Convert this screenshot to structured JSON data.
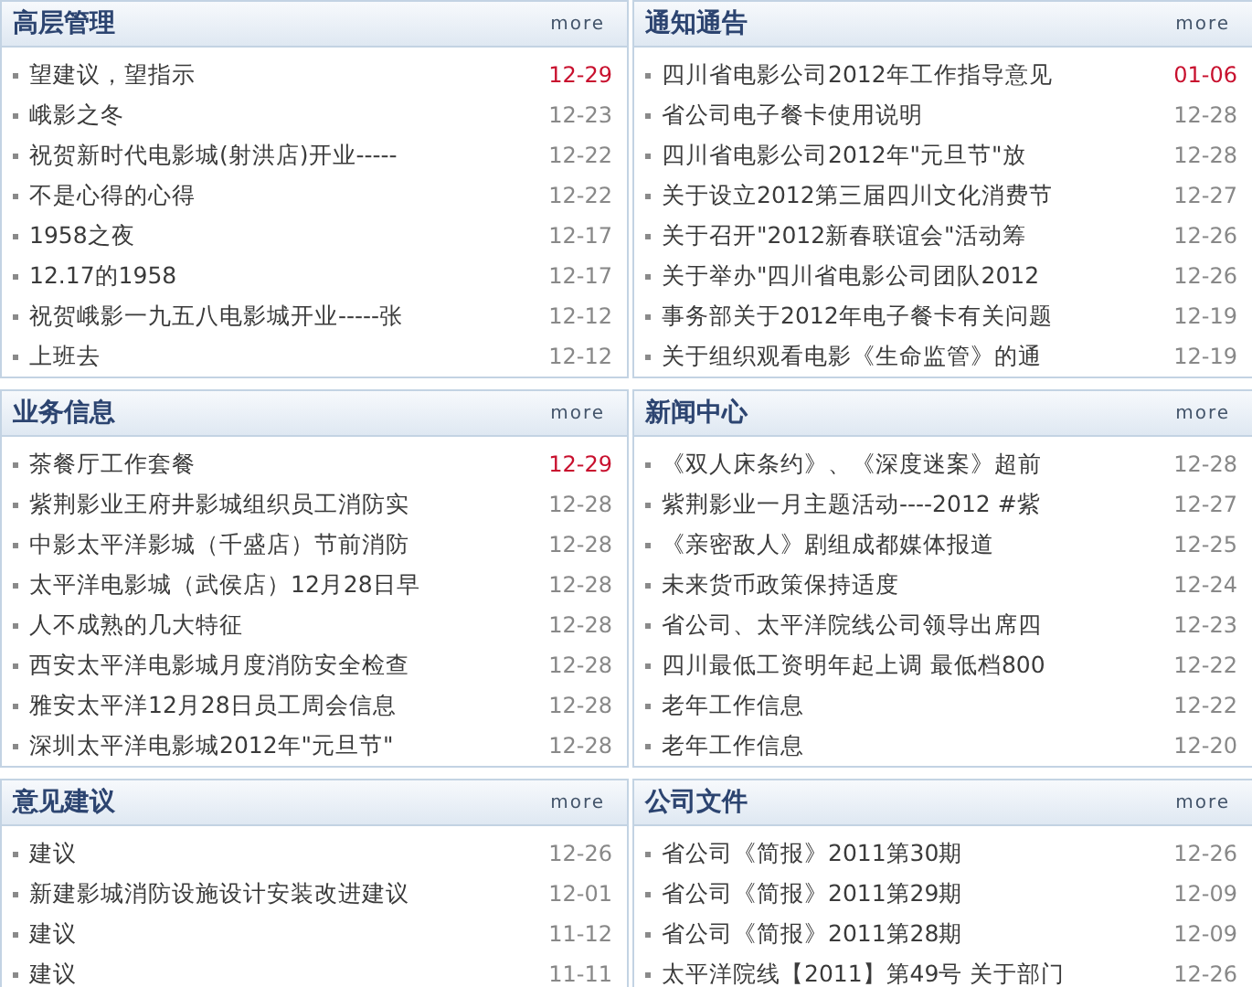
{
  "panels": [
    {
      "title": "高层管理",
      "more": "more",
      "items": [
        {
          "title": "望建议，望指示",
          "date": "12-29",
          "new": true
        },
        {
          "title": "峨影之冬",
          "date": "12-23",
          "new": false
        },
        {
          "title": "祝贺新时代电影城(射洪店)开业-----",
          "date": "12-22",
          "new": false
        },
        {
          "title": "不是心得的心得",
          "date": "12-22",
          "new": false
        },
        {
          "title": "1958之夜",
          "date": "12-17",
          "new": false
        },
        {
          "title": "12.17的1958",
          "date": "12-17",
          "new": false
        },
        {
          "title": "祝贺峨影一九五八电影城开业-----张",
          "date": "12-12",
          "new": false
        },
        {
          "title": "上班去",
          "date": "12-12",
          "new": false
        }
      ]
    },
    {
      "title": "通知通告",
      "more": "more",
      "items": [
        {
          "title": "四川省电影公司2012年工作指导意见",
          "date": "01-06",
          "new": true
        },
        {
          "title": "省公司电子餐卡使用说明",
          "date": "12-28",
          "new": false
        },
        {
          "title": "四川省电影公司2012年\"元旦节\"放",
          "date": "12-28",
          "new": false
        },
        {
          "title": "关于设立2012第三届四川文化消费节",
          "date": "12-27",
          "new": false
        },
        {
          "title": "关于召开\"2012新春联谊会\"活动筹",
          "date": "12-26",
          "new": false
        },
        {
          "title": "关于举办\"四川省电影公司团队2012",
          "date": "12-26",
          "new": false
        },
        {
          "title": "事务部关于2012年电子餐卡有关问题",
          "date": "12-19",
          "new": false
        },
        {
          "title": "关于组织观看电影《生命监管》的通",
          "date": "12-19",
          "new": false
        }
      ]
    },
    {
      "title": "业务信息",
      "more": "more",
      "items": [
        {
          "title": "茶餐厅工作套餐",
          "date": "12-29",
          "new": true
        },
        {
          "title": "紫荆影业王府井影城组织员工消防实",
          "date": "12-28",
          "new": false
        },
        {
          "title": "中影太平洋影城（千盛店）节前消防",
          "date": "12-28",
          "new": false
        },
        {
          "title": "太平洋电影城（武侯店）12月28日早",
          "date": "12-28",
          "new": false
        },
        {
          "title": "人不成熟的几大特征",
          "date": "12-28",
          "new": false
        },
        {
          "title": "西安太平洋电影城月度消防安全检查",
          "date": "12-28",
          "new": false
        },
        {
          "title": "雅安太平洋12月28日员工周会信息",
          "date": "12-28",
          "new": false
        },
        {
          "title": "深圳太平洋电影城2012年\"元旦节\"",
          "date": "12-28",
          "new": false
        }
      ]
    },
    {
      "title": "新闻中心",
      "more": "more",
      "items": [
        {
          "title": "《双人床条约》、《深度迷案》超前",
          "date": "12-28",
          "new": false
        },
        {
          "title": "紫荆影业一月主题活动----2012 #紫",
          "date": "12-27",
          "new": false
        },
        {
          "title": "《亲密敌人》剧组成都媒体报道",
          "date": "12-25",
          "new": false
        },
        {
          "title": "未来货币政策保持适度",
          "date": "12-24",
          "new": false
        },
        {
          "title": "省公司、太平洋院线公司领导出席四",
          "date": "12-23",
          "new": false
        },
        {
          "title": "四川最低工资明年起上调 最低档800",
          "date": "12-22",
          "new": false
        },
        {
          "title": "老年工作信息",
          "date": "12-22",
          "new": false
        },
        {
          "title": "老年工作信息",
          "date": "12-20",
          "new": false
        }
      ]
    },
    {
      "title": "意见建议",
      "more": "more",
      "items": [
        {
          "title": "建议",
          "date": "12-26",
          "new": false
        },
        {
          "title": "新建影城消防设施设计安装改进建议",
          "date": "12-01",
          "new": false
        },
        {
          "title": "建议",
          "date": "11-12",
          "new": false
        },
        {
          "title": "建议",
          "date": "11-11",
          "new": false
        }
      ]
    },
    {
      "title": "公司文件",
      "more": "more",
      "items": [
        {
          "title": "省公司《简报》2011第30期",
          "date": "12-26",
          "new": false
        },
        {
          "title": "省公司《简报》2011第29期",
          "date": "12-09",
          "new": false
        },
        {
          "title": "省公司《简报》2011第28期",
          "date": "12-09",
          "new": false
        },
        {
          "title": "太平洋院线【2011】第49号 关于部门",
          "date": "12-26",
          "new": false
        }
      ]
    }
  ]
}
